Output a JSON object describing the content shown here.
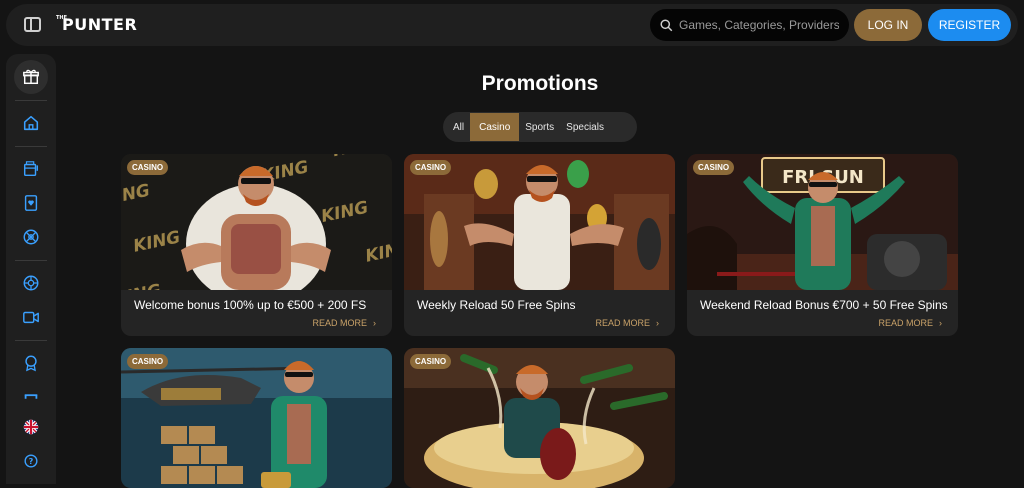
{
  "header": {
    "logo_small": "THE",
    "logo_main": "PUNTER",
    "search_placeholder": "Games, Categories, Providers",
    "login_label": "LOG IN",
    "register_label": "REGISTER"
  },
  "page": {
    "title": "Promotions",
    "tabs": [
      {
        "label": "All",
        "active": false
      },
      {
        "label": "Casino",
        "active": true
      },
      {
        "label": "Sports",
        "active": false
      },
      {
        "label": "Specials",
        "active": false
      }
    ]
  },
  "promotions": [
    {
      "badge": "CASINO",
      "title": "Welcome bonus 100% up to €500 + 200 FS",
      "cta": "READ MORE"
    },
    {
      "badge": "CASINO",
      "title": "Weekly Reload 50 Free Spins",
      "cta": "READ MORE"
    },
    {
      "badge": "CASINO",
      "title": "Weekend Reload Bonus €700 + 50 Free Spins",
      "cta": "READ MORE"
    },
    {
      "badge": "CASINO",
      "title": "",
      "cta": ""
    },
    {
      "badge": "CASINO",
      "title": "",
      "cta": ""
    }
  ],
  "image_text": {
    "king": "KING",
    "sign": "FRI SUN"
  },
  "colors": {
    "gold_accent": "#8c6a39",
    "read_more": "#c9a269",
    "register_blue": "#1c8cf0",
    "nav_icon_blue": "#3aa0ff"
  },
  "sidebar_icons": [
    "gift-icon",
    "home-icon",
    "slots-icon",
    "card-icon",
    "sports-icon",
    "live-casino-icon",
    "live-video-icon",
    "vip-badge-icon",
    "trophy-bar-icon",
    "uk-flag-icon",
    "help-icon"
  ]
}
